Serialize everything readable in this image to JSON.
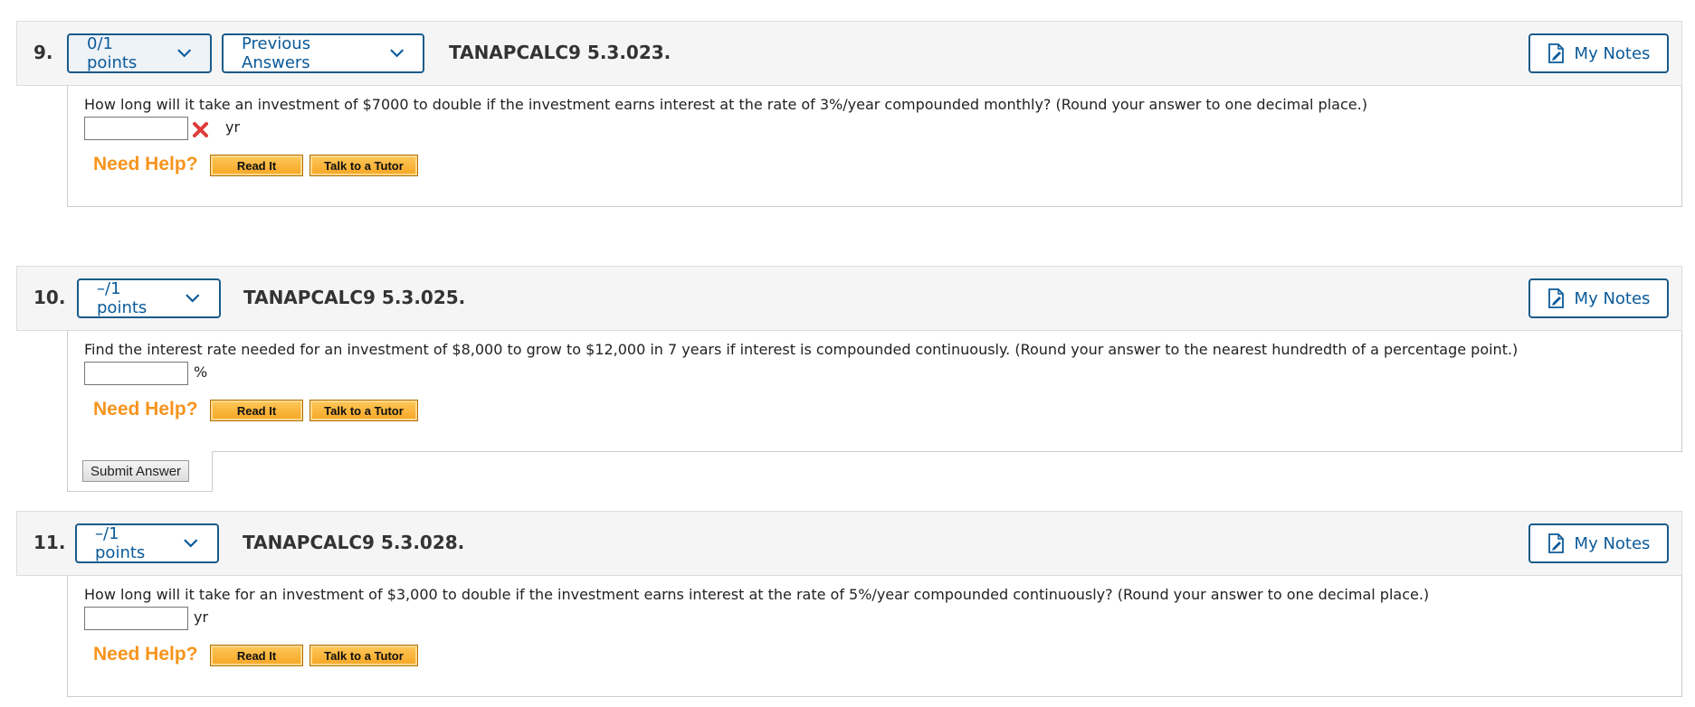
{
  "questions": [
    {
      "number": "9.",
      "points_label": "0/1 points",
      "previous_answers_label": "Previous Answers",
      "code": "TANAPCALC9 5.3.023.",
      "notes_label": "My Notes",
      "text": "How long will it take an investment of $7000 to double if the investment earns interest at the rate of 3%/year compounded monthly? (Round your answer to one decimal place.)",
      "answer_value": "",
      "unit": "yr",
      "marked_incorrect": true,
      "help_label": "Need Help?",
      "read_it_label": "Read It",
      "tutor_label": "Talk to a Tutor"
    },
    {
      "number": "10.",
      "points_label": "–/1 points",
      "code": "TANAPCALC9 5.3.025.",
      "notes_label": "My Notes",
      "text": "Find the interest rate needed for an investment of $8,000 to grow to $12,000 in 7 years if interest is compounded continuously. (Round your answer to the nearest hundredth of a percentage point.)",
      "answer_value": "",
      "unit": "%",
      "help_label": "Need Help?",
      "read_it_label": "Read It",
      "tutor_label": "Talk to a Tutor",
      "submit_label": "Submit Answer"
    },
    {
      "number": "11.",
      "points_label": "–/1 points",
      "code": "TANAPCALC9 5.3.028.",
      "notes_label": "My Notes",
      "text": "How long will it take for an investment of $3,000 to double if the investment earns interest at the rate of 5%/year compounded continuously? (Round your answer to one decimal place.)",
      "answer_value": "",
      "unit": "yr",
      "help_label": "Need Help?",
      "read_it_label": "Read It",
      "tutor_label": "Talk to a Tutor"
    }
  ],
  "icons": {
    "points_dropdown": "chevron-down-icon",
    "notes": "note-edit-icon",
    "incorrect": "red-x-icon"
  },
  "colors": {
    "accent_blue": "#0a5a99",
    "help_orange": "#f7941d",
    "incorrect_red": "#e03a3a"
  }
}
